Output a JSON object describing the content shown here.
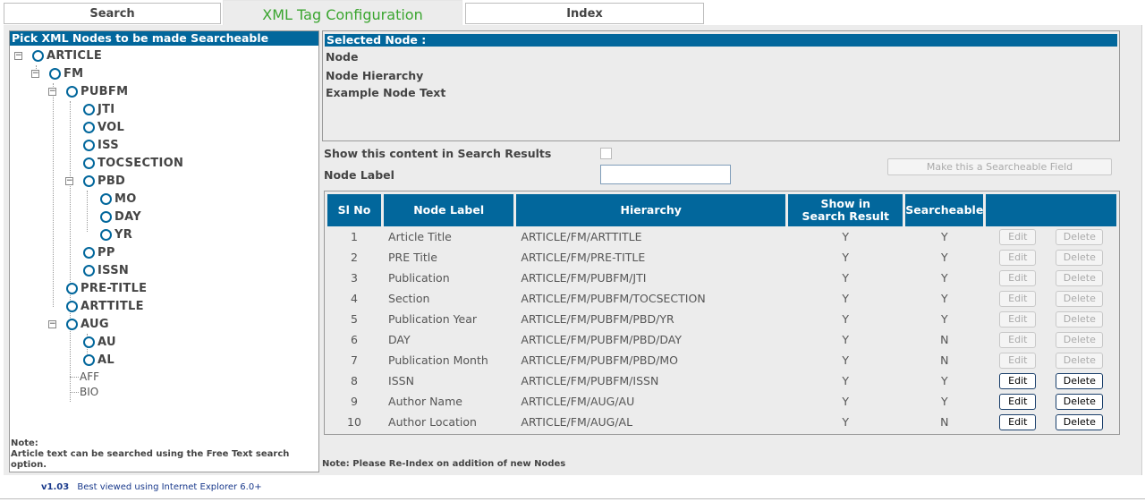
{
  "tabs": [
    {
      "label": "Search"
    },
    {
      "label": "XML Tag Configuration"
    },
    {
      "label": "Index"
    }
  ],
  "left_panel": {
    "header": "Pick XML Nodes to be made Searcheable",
    "note_title": "Note:",
    "note_text": "Article text can be searched using the Free Text search option."
  },
  "tree": {
    "article": "ARTICLE",
    "fm": "FM",
    "pubfm": "PUBFM",
    "jti": "JTI",
    "vol": "VOL",
    "iss": "ISS",
    "tocsection": "TOCSECTION",
    "pbd": "PBD",
    "mo": "MO",
    "day": "DAY",
    "yr": "YR",
    "pp": "PP",
    "issn": "ISSN",
    "pretitle": "PRE-TITLE",
    "arttitle": "ARTTITLE",
    "aug": "AUG",
    "au": "AU",
    "al": "AL",
    "aff": "AFF",
    "bio": "BIO"
  },
  "selected_node": {
    "header": "Selected Node :",
    "node": "Node",
    "hierarchy": "Node Hierarchy",
    "example": "Example Node Text"
  },
  "form": {
    "show_label": "Show this content in Search Results",
    "node_label": "Node Label",
    "node_label_value": "",
    "make_searchable": "Make this a Searcheable Field"
  },
  "table": {
    "headers": {
      "slno": "Sl No",
      "label": "Node Label",
      "hierarchy": "Hierarchy",
      "show_line1": "Show in",
      "show_line2": "Search Result",
      "searchable": "Searcheable"
    },
    "edit_label": "Edit",
    "delete_label": "Delete",
    "rows": [
      {
        "no": "1",
        "label": "Article Title",
        "hierarchy": "ARTICLE/FM/ARTTITLE",
        "show": "Y",
        "searchable": "Y"
      },
      {
        "no": "2",
        "label": "PRE Title",
        "hierarchy": "ARTICLE/FM/PRE-TITLE",
        "show": "Y",
        "searchable": "Y"
      },
      {
        "no": "3",
        "label": "Publication",
        "hierarchy": "ARTICLE/FM/PUBFM/JTI",
        "show": "Y",
        "searchable": "Y"
      },
      {
        "no": "4",
        "label": "Section",
        "hierarchy": "ARTICLE/FM/PUBFM/TOCSECTION",
        "show": "Y",
        "searchable": "Y"
      },
      {
        "no": "5",
        "label": "Publication Year",
        "hierarchy": "ARTICLE/FM/PUBFM/PBD/YR",
        "show": "Y",
        "searchable": "Y"
      },
      {
        "no": "6",
        "label": "DAY",
        "hierarchy": "ARTICLE/FM/PUBFM/PBD/DAY",
        "show": "Y",
        "searchable": "N"
      },
      {
        "no": "7",
        "label": "Publication Month",
        "hierarchy": "ARTICLE/FM/PUBFM/PBD/MO",
        "show": "Y",
        "searchable": "N"
      },
      {
        "no": "8",
        "label": "ISSN",
        "hierarchy": "ARTICLE/FM/PUBFM/ISSN",
        "show": "Y",
        "searchable": "Y"
      },
      {
        "no": "9",
        "label": "Author Name",
        "hierarchy": "ARTICLE/FM/AUG/AU",
        "show": "Y",
        "searchable": "Y"
      },
      {
        "no": "10",
        "label": "Author Location",
        "hierarchy": "ARTICLE/FM/AUG/AL",
        "show": "Y",
        "searchable": "N"
      }
    ]
  },
  "bottom_note": "Note: Please Re-Index on addition of new Nodes",
  "footer": {
    "version": "v1.03",
    "text": "Best viewed using Internet Explorer 6.0+"
  },
  "colors": {
    "header_blue": "#02679c",
    "active_tab_green": "#3aa52f",
    "panel_bg": "#ececec"
  }
}
